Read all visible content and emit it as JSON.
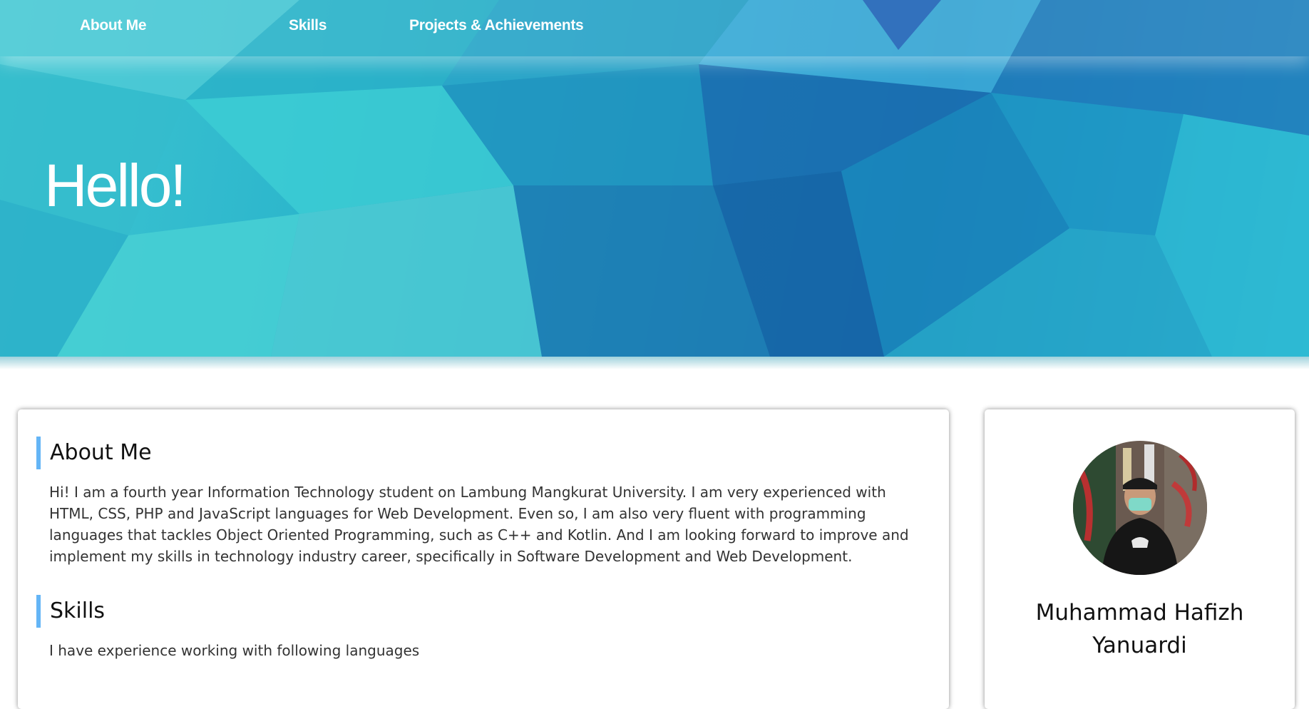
{
  "nav": {
    "items": [
      {
        "label": "About Me"
      },
      {
        "label": "Skills"
      },
      {
        "label": "Projects & Achievements"
      }
    ]
  },
  "hero": {
    "title": "Hello!"
  },
  "about": {
    "heading": "About Me",
    "text": "Hi! I am a fourth year Information Technology student on Lambung Mangkurat University. I am very experienced with HTML, CSS, PHP and JavaScript languages for Web Development. Even so, I am also very fluent with programming languages that tackles Object Oriented Programming, such as C++ and Kotlin. And I am looking forward to improve and implement my skills in technology industry career, specifically in Software Development and Web Development."
  },
  "skills": {
    "heading": "Skills",
    "text": "I have experience working with following languages"
  },
  "profile": {
    "name": "Muhammad Hafizh Yanuardi"
  },
  "colors": {
    "accent": "#64b5f6",
    "hero_light": "#3fc6d2",
    "hero_dark": "#1c6fb0"
  }
}
